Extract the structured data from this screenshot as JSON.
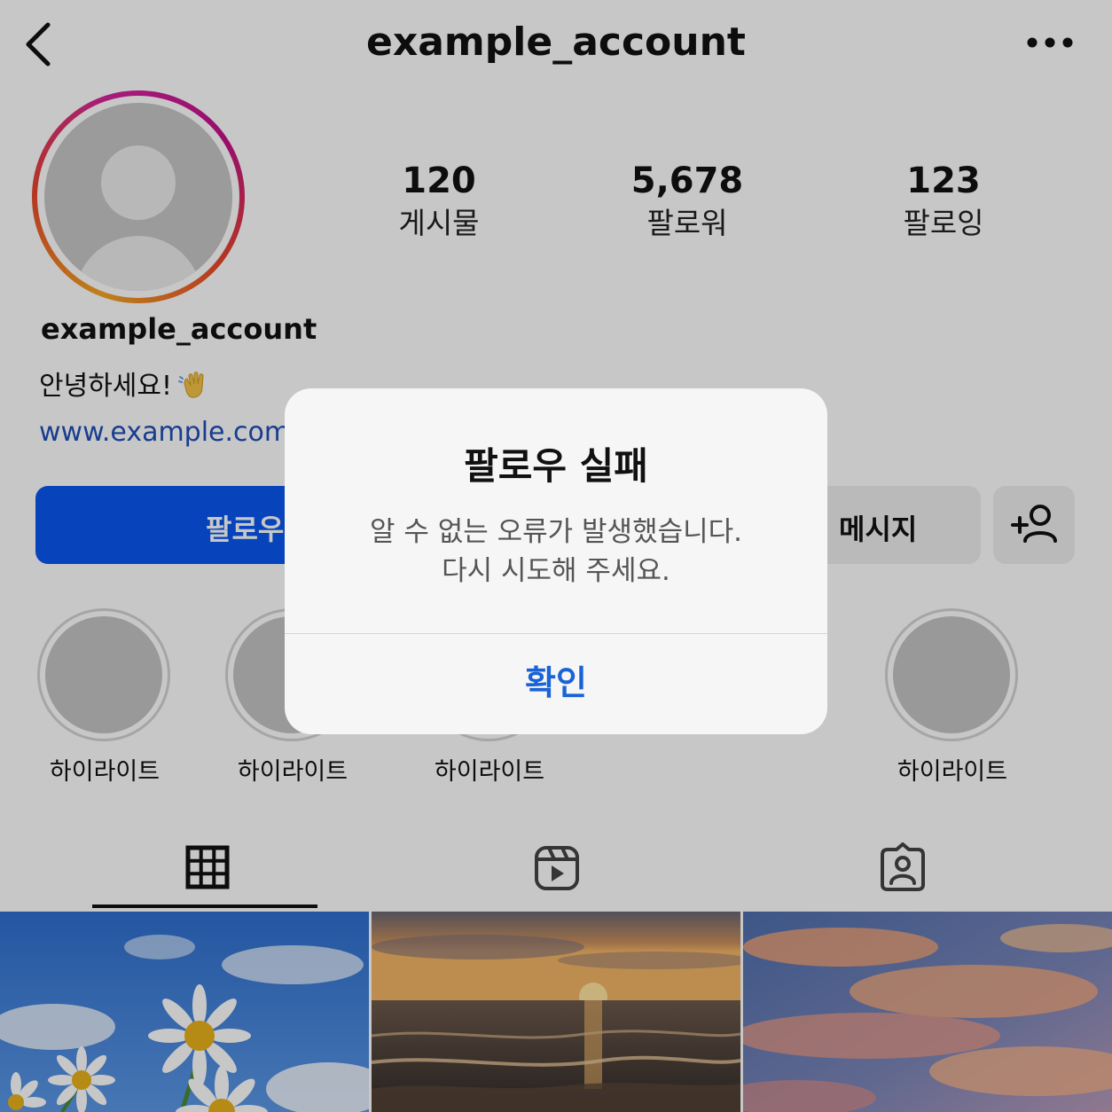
{
  "header": {
    "title": "example_account",
    "back_icon": "chevron-left-icon",
    "more_icon": "more-horizontal-icon"
  },
  "profile": {
    "username": "example_account",
    "bio": "안녕하세요!",
    "bio_emoji_icon": "waving-hand-icon",
    "website": "www.example.com"
  },
  "stats": [
    {
      "value": "120",
      "label": "게시물"
    },
    {
      "value": "5,678",
      "label": "팔로워"
    },
    {
      "value": "123",
      "label": "팔로잉"
    }
  ],
  "actions": {
    "follow_label": "팔로우",
    "message_label": "메시지",
    "add_person_icon": "add-person-icon"
  },
  "highlights": [
    {
      "label": "하이라이트"
    },
    {
      "label": "하이라이트"
    },
    {
      "label": "하이라이트"
    },
    {
      "label": "하이라이트"
    }
  ],
  "tabs": [
    {
      "icon": "grid-icon",
      "active": true
    },
    {
      "icon": "reels-icon",
      "active": false
    },
    {
      "icon": "tagged-icon",
      "active": false
    }
  ],
  "grid_photos": [
    "daisies under blue sky",
    "sunset over sea",
    "pink clouds at sunset"
  ],
  "dialog": {
    "title": "팔로우 실패",
    "message_line1": "알 수 없는 오류가 발생했습니다.",
    "message_line2": "다시 시도해 주세요.",
    "confirm_label": "확인"
  },
  "colors": {
    "follow_button": "#0a56ef",
    "link": "#1f4fb8",
    "confirm": "#1a63d6"
  }
}
